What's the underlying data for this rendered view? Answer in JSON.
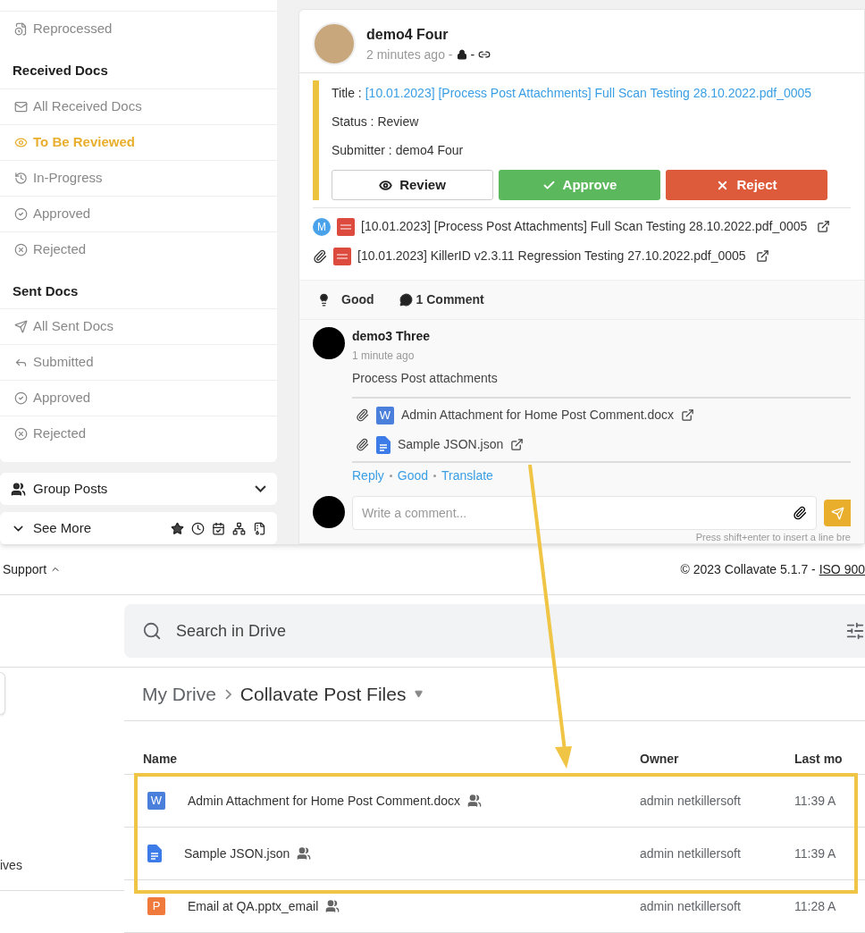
{
  "sidebar": {
    "items": [
      {
        "kind": "item",
        "label": "Reprocessed",
        "selected": false
      },
      {
        "kind": "heading",
        "label": "Received Docs"
      },
      {
        "kind": "item",
        "label": "All Received Docs",
        "selected": false
      },
      {
        "kind": "item",
        "label": "To Be Reviewed",
        "selected": true
      },
      {
        "kind": "item",
        "label": "In-Progress",
        "selected": false
      },
      {
        "kind": "item",
        "label": "Approved",
        "selected": false
      },
      {
        "kind": "item",
        "label": "Rejected",
        "selected": false
      },
      {
        "kind": "heading",
        "label": "Sent Docs"
      },
      {
        "kind": "item",
        "label": "All Sent Docs",
        "selected": false
      },
      {
        "kind": "item",
        "label": "Submitted",
        "selected": false
      },
      {
        "kind": "item",
        "label": "Approved",
        "selected": false
      },
      {
        "kind": "item",
        "label": "Rejected",
        "selected": false
      }
    ],
    "group_posts": {
      "label": "Group Posts",
      "expanded": false
    },
    "see_more": {
      "label": "See More"
    }
  },
  "post": {
    "author": "demo4 Four",
    "time": "2 minutes ago -",
    "separator": "-",
    "fields": [
      {
        "label": "Title :",
        "value": "[10.01.2023] [Process Post Attachments] Full Scan Testing 28.10.2022.pdf_0005",
        "kind": "link"
      },
      {
        "label": "Status :",
        "value": "Review",
        "kind": "text"
      },
      {
        "label": "Submitter :",
        "value": "demo4 Four",
        "kind": "text"
      }
    ],
    "buttons": [
      {
        "label": "Review",
        "kind": "review"
      },
      {
        "label": "Approve",
        "kind": "approve"
      },
      {
        "label": "Reject",
        "kind": "reject"
      }
    ],
    "attachments": [
      {
        "kind": "main",
        "badge": "M",
        "name": "[10.01.2023] [Process Post Attachments] Full Scan Testing 28.10.2022.pdf_0005"
      },
      {
        "kind": "attached",
        "name": "[10.01.2023] KillerID v2.3.11 Regression Testing 27.10.2022.pdf_0005"
      }
    ],
    "reaction": "Good",
    "comments_count": "1 Comment",
    "comment": {
      "author": "demo3 Three",
      "time": "1 minute ago",
      "text": "Process Post attachments",
      "attachments": [
        {
          "kind": "word",
          "badge": "W",
          "name": "Admin Attachment for Home Post Comment.docx"
        },
        {
          "kind": "doc",
          "name": "Sample JSON.json"
        }
      ],
      "actions": [
        "Reply",
        "Good",
        "Translate"
      ]
    },
    "comment_input": {
      "placeholder": "Write a comment...",
      "hint": "Press shift+enter to insert a line bre"
    }
  },
  "footer": {
    "support": "Support",
    "copyright": "© 2023 Collavate 5.1.7 - ",
    "iso_link": "ISO 900"
  },
  "drive": {
    "search": {
      "placeholder": "Search in Drive"
    },
    "breadcrumb": [
      "My Drive",
      "Collavate Post Files"
    ],
    "nav_fragment": "ives",
    "columns": [
      "Name",
      "Owner",
      "Last mo"
    ],
    "rows": [
      {
        "kind": "word",
        "badge": "W",
        "name": "Admin Attachment for Home Post Comment.docx",
        "owner": "admin netkillersoft",
        "time": "11:39 A"
      },
      {
        "kind": "doc",
        "name": "Sample JSON.json",
        "owner": "admin netkillersoft",
        "time": "11:39 A"
      },
      {
        "kind": "slides",
        "badge": "P",
        "name": "Email at QA.pptx_email",
        "owner": "admin netkillersoft",
        "time": "11:28 A"
      }
    ]
  }
}
